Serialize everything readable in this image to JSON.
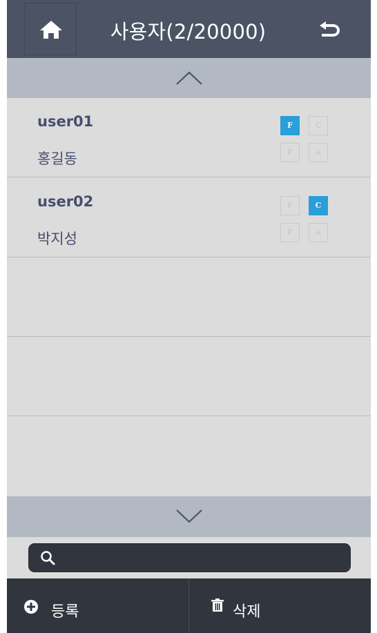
{
  "header": {
    "title": "사용자(2/20000)",
    "home_icon": "home-icon",
    "back_icon": "undo-arrow-icon"
  },
  "users": [
    {
      "id": "user01",
      "name": "홍길동",
      "badges": [
        {
          "label": "F",
          "active": true
        },
        {
          "label": "C",
          "active": false
        },
        {
          "label": "P",
          "active": false
        },
        {
          "label": "A",
          "active": false
        }
      ]
    },
    {
      "id": "user02",
      "name": "박지성",
      "badges": [
        {
          "label": "F",
          "active": false
        },
        {
          "label": "C",
          "active": true
        },
        {
          "label": "P",
          "active": false
        },
        {
          "label": "A",
          "active": false
        }
      ]
    }
  ],
  "search": {
    "placeholder": "",
    "value": ""
  },
  "bottom_bar": {
    "register_label": "등록",
    "delete_label": "삭제",
    "register_icon": "plus-circle-icon",
    "delete_icon": "trash-icon"
  },
  "colors": {
    "header_bg": "#4b5364",
    "list_bg": "#dcdcdc",
    "scroll_bar_bg": "#b3b9c2",
    "badge_active": "#2a9fd9",
    "bottom_bar_bg": "#31353d",
    "text_primary": "#47506a"
  }
}
